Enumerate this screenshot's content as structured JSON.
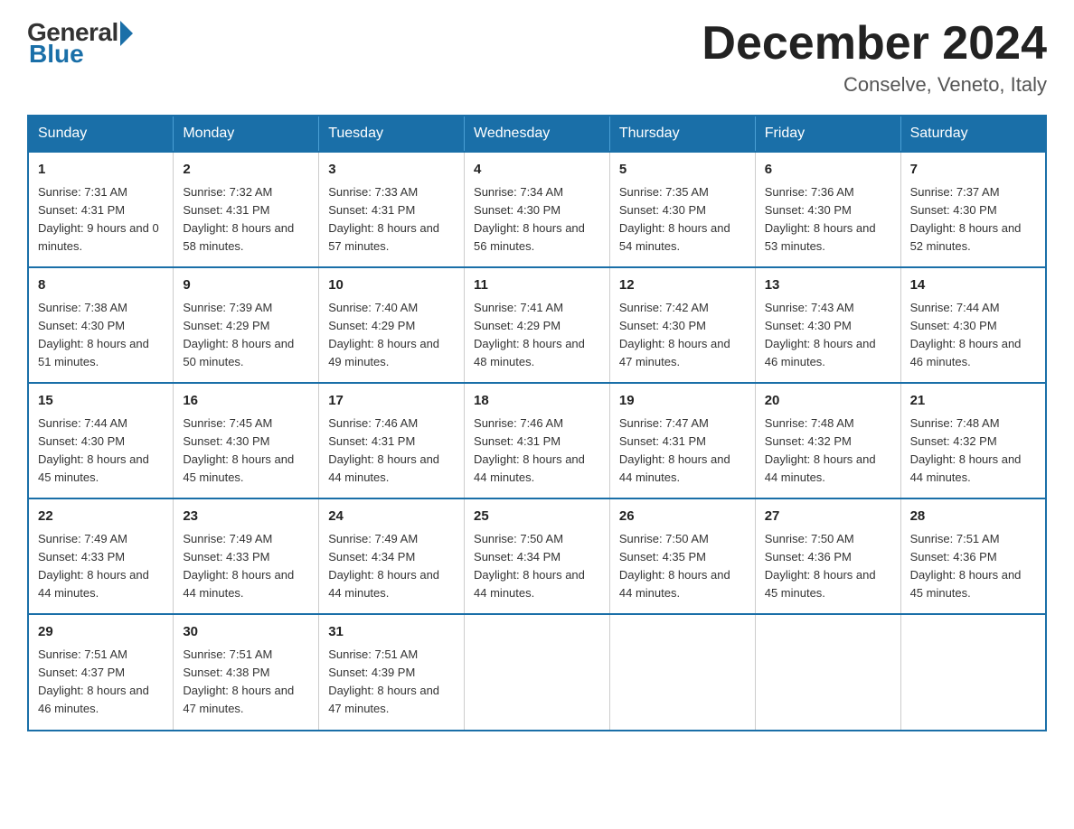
{
  "logo": {
    "general": "General",
    "blue": "Blue"
  },
  "header": {
    "month": "December 2024",
    "location": "Conselve, Veneto, Italy"
  },
  "weekdays": [
    "Sunday",
    "Monday",
    "Tuesday",
    "Wednesday",
    "Thursday",
    "Friday",
    "Saturday"
  ],
  "weeks": [
    [
      {
        "day": "1",
        "sunrise": "7:31 AM",
        "sunset": "4:31 PM",
        "daylight": "9 hours and 0 minutes."
      },
      {
        "day": "2",
        "sunrise": "7:32 AM",
        "sunset": "4:31 PM",
        "daylight": "8 hours and 58 minutes."
      },
      {
        "day": "3",
        "sunrise": "7:33 AM",
        "sunset": "4:31 PM",
        "daylight": "8 hours and 57 minutes."
      },
      {
        "day": "4",
        "sunrise": "7:34 AM",
        "sunset": "4:30 PM",
        "daylight": "8 hours and 56 minutes."
      },
      {
        "day": "5",
        "sunrise": "7:35 AM",
        "sunset": "4:30 PM",
        "daylight": "8 hours and 54 minutes."
      },
      {
        "day": "6",
        "sunrise": "7:36 AM",
        "sunset": "4:30 PM",
        "daylight": "8 hours and 53 minutes."
      },
      {
        "day": "7",
        "sunrise": "7:37 AM",
        "sunset": "4:30 PM",
        "daylight": "8 hours and 52 minutes."
      }
    ],
    [
      {
        "day": "8",
        "sunrise": "7:38 AM",
        "sunset": "4:30 PM",
        "daylight": "8 hours and 51 minutes."
      },
      {
        "day": "9",
        "sunrise": "7:39 AM",
        "sunset": "4:29 PM",
        "daylight": "8 hours and 50 minutes."
      },
      {
        "day": "10",
        "sunrise": "7:40 AM",
        "sunset": "4:29 PM",
        "daylight": "8 hours and 49 minutes."
      },
      {
        "day": "11",
        "sunrise": "7:41 AM",
        "sunset": "4:29 PM",
        "daylight": "8 hours and 48 minutes."
      },
      {
        "day": "12",
        "sunrise": "7:42 AM",
        "sunset": "4:30 PM",
        "daylight": "8 hours and 47 minutes."
      },
      {
        "day": "13",
        "sunrise": "7:43 AM",
        "sunset": "4:30 PM",
        "daylight": "8 hours and 46 minutes."
      },
      {
        "day": "14",
        "sunrise": "7:44 AM",
        "sunset": "4:30 PM",
        "daylight": "8 hours and 46 minutes."
      }
    ],
    [
      {
        "day": "15",
        "sunrise": "7:44 AM",
        "sunset": "4:30 PM",
        "daylight": "8 hours and 45 minutes."
      },
      {
        "day": "16",
        "sunrise": "7:45 AM",
        "sunset": "4:30 PM",
        "daylight": "8 hours and 45 minutes."
      },
      {
        "day": "17",
        "sunrise": "7:46 AM",
        "sunset": "4:31 PM",
        "daylight": "8 hours and 44 minutes."
      },
      {
        "day": "18",
        "sunrise": "7:46 AM",
        "sunset": "4:31 PM",
        "daylight": "8 hours and 44 minutes."
      },
      {
        "day": "19",
        "sunrise": "7:47 AM",
        "sunset": "4:31 PM",
        "daylight": "8 hours and 44 minutes."
      },
      {
        "day": "20",
        "sunrise": "7:48 AM",
        "sunset": "4:32 PM",
        "daylight": "8 hours and 44 minutes."
      },
      {
        "day": "21",
        "sunrise": "7:48 AM",
        "sunset": "4:32 PM",
        "daylight": "8 hours and 44 minutes."
      }
    ],
    [
      {
        "day": "22",
        "sunrise": "7:49 AM",
        "sunset": "4:33 PM",
        "daylight": "8 hours and 44 minutes."
      },
      {
        "day": "23",
        "sunrise": "7:49 AM",
        "sunset": "4:33 PM",
        "daylight": "8 hours and 44 minutes."
      },
      {
        "day": "24",
        "sunrise": "7:49 AM",
        "sunset": "4:34 PM",
        "daylight": "8 hours and 44 minutes."
      },
      {
        "day": "25",
        "sunrise": "7:50 AM",
        "sunset": "4:34 PM",
        "daylight": "8 hours and 44 minutes."
      },
      {
        "day": "26",
        "sunrise": "7:50 AM",
        "sunset": "4:35 PM",
        "daylight": "8 hours and 44 minutes."
      },
      {
        "day": "27",
        "sunrise": "7:50 AM",
        "sunset": "4:36 PM",
        "daylight": "8 hours and 45 minutes."
      },
      {
        "day": "28",
        "sunrise": "7:51 AM",
        "sunset": "4:36 PM",
        "daylight": "8 hours and 45 minutes."
      }
    ],
    [
      {
        "day": "29",
        "sunrise": "7:51 AM",
        "sunset": "4:37 PM",
        "daylight": "8 hours and 46 minutes."
      },
      {
        "day": "30",
        "sunrise": "7:51 AM",
        "sunset": "4:38 PM",
        "daylight": "8 hours and 47 minutes."
      },
      {
        "day": "31",
        "sunrise": "7:51 AM",
        "sunset": "4:39 PM",
        "daylight": "8 hours and 47 minutes."
      },
      null,
      null,
      null,
      null
    ]
  ]
}
